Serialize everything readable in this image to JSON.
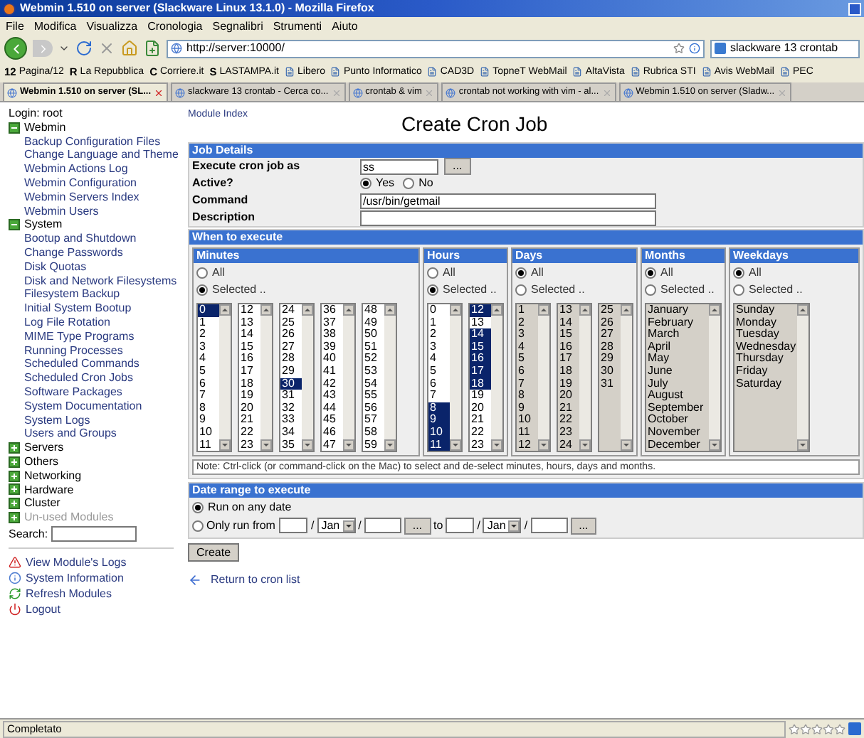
{
  "window": {
    "title": "Webmin 1.510 on server (Slackware Linux 13.1.0) - Mozilla Firefox"
  },
  "menu": [
    "File",
    "Modifica",
    "Visualizza",
    "Cronologia",
    "Segnalibri",
    "Strumenti",
    "Aiuto"
  ],
  "toolbar": {
    "url": "http://server:10000/",
    "search": "slackware 13 crontab"
  },
  "bookmarks": [
    {
      "logo": "12",
      "label": "Pagina/12"
    },
    {
      "logo": "R",
      "label": "La Repubblica"
    },
    {
      "logo": "C",
      "label": "Corriere.it"
    },
    {
      "logo": "S",
      "label": "LASTAMPA.it"
    },
    {
      "label": "Libero"
    },
    {
      "label": "Punto Informatico"
    },
    {
      "label": "CAD3D"
    },
    {
      "label": "TopneT WebMail"
    },
    {
      "label": "AltaVista"
    },
    {
      "label": "Rubrica STI"
    },
    {
      "label": "Avis WebMail"
    },
    {
      "label": "PEC"
    }
  ],
  "tabs": [
    {
      "label": "Webmin 1.510 on server (SL...",
      "selected": true
    },
    {
      "label": "slackware 13 crontab - Cerca co...",
      "selected": false
    },
    {
      "label": "crontab & vim",
      "selected": false
    },
    {
      "label": "crontab not working with vim - al...",
      "selected": false
    },
    {
      "label": "Webmin 1.510 on server (Sladw...",
      "selected": false
    }
  ],
  "sidebar": {
    "login": "Login: root",
    "categories": [
      {
        "label": "Webmin",
        "expanded": true,
        "disabled": false,
        "children": [
          "Backup Configuration Files",
          "Change Language and Theme",
          "Webmin Actions Log",
          "Webmin Configuration",
          "Webmin Servers Index",
          "Webmin Users"
        ]
      },
      {
        "label": "System",
        "expanded": true,
        "disabled": false,
        "children": [
          "Bootup and Shutdown",
          "Change Passwords",
          "Disk Quotas",
          "Disk and Network Filesystems",
          "Filesystem Backup",
          "Initial System Bootup",
          "Log File Rotation",
          "MIME Type Programs",
          "Running Processes",
          "Scheduled Commands",
          "Scheduled Cron Jobs",
          "Software Packages",
          "System Documentation",
          "System Logs",
          "Users and Groups"
        ]
      },
      {
        "label": "Servers",
        "expanded": false,
        "disabled": false
      },
      {
        "label": "Others",
        "expanded": false,
        "disabled": false
      },
      {
        "label": "Networking",
        "expanded": false,
        "disabled": false
      },
      {
        "label": "Hardware",
        "expanded": false,
        "disabled": false
      },
      {
        "label": "Cluster",
        "expanded": false,
        "disabled": false
      },
      {
        "label": "Un-used Modules",
        "expanded": false,
        "disabled": true
      }
    ],
    "search_label": "Search:",
    "links": [
      {
        "kind": "warning",
        "label": "View Module's Logs"
      },
      {
        "kind": "info",
        "label": "System Information"
      },
      {
        "kind": "refresh",
        "label": "Refresh Modules"
      },
      {
        "kind": "logout",
        "label": "Logout"
      }
    ]
  },
  "module_index": "Module Index",
  "title": "Create Cron Job",
  "job_details": {
    "heading": "Job Details",
    "fields": [
      {
        "kind": "user",
        "label": "Execute cron job as",
        "value": "ss",
        "button": "..."
      },
      {
        "kind": "radio",
        "label": "Active?",
        "options": [
          {
            "label": "Yes",
            "selected": true
          },
          {
            "label": "No",
            "selected": false
          }
        ]
      },
      {
        "kind": "text",
        "label": "Command",
        "value": "/usr/bin/getmail"
      },
      {
        "kind": "text",
        "label": "Description"
      }
    ]
  },
  "when": {
    "heading": "When to execute",
    "groups": [
      {
        "heading": "Minutes",
        "options": [
          {
            "label": "All",
            "selected": false
          },
          {
            "label": "Selected ..",
            "selected": true
          }
        ],
        "lists": [
          [
            {
              "label": "0",
              "selected": true
            },
            {
              "label": "1",
              "selected": false
            },
            {
              "label": "2",
              "selected": false
            },
            {
              "label": "3",
              "selected": false
            },
            {
              "label": "4",
              "selected": false
            },
            {
              "label": "5",
              "selected": false
            },
            {
              "label": "6",
              "selected": false
            },
            {
              "label": "7",
              "selected": false
            },
            {
              "label": "8",
              "selected": false
            },
            {
              "label": "9",
              "selected": false
            },
            {
              "label": "10",
              "selected": false
            },
            {
              "label": "11",
              "selected": false
            }
          ],
          [
            {
              "label": "12",
              "selected": false
            },
            {
              "label": "13",
              "selected": false
            },
            {
              "label": "14",
              "selected": false
            },
            {
              "label": "15",
              "selected": false
            },
            {
              "label": "16",
              "selected": false
            },
            {
              "label": "17",
              "selected": false
            },
            {
              "label": "18",
              "selected": false
            },
            {
              "label": "19",
              "selected": false
            },
            {
              "label": "20",
              "selected": false
            },
            {
              "label": "21",
              "selected": false
            },
            {
              "label": "22",
              "selected": false
            },
            {
              "label": "23",
              "selected": false
            }
          ],
          [
            {
              "label": "24",
              "selected": false
            },
            {
              "label": "25",
              "selected": false
            },
            {
              "label": "26",
              "selected": false
            },
            {
              "label": "27",
              "selected": false
            },
            {
              "label": "28",
              "selected": false
            },
            {
              "label": "29",
              "selected": false
            },
            {
              "label": "30",
              "selected": true
            },
            {
              "label": "31",
              "selected": false
            },
            {
              "label": "32",
              "selected": false
            },
            {
              "label": "33",
              "selected": false
            },
            {
              "label": "34",
              "selected": false
            },
            {
              "label": "35",
              "selected": false
            }
          ],
          [
            {
              "label": "36",
              "selected": false
            },
            {
              "label": "37",
              "selected": false
            },
            {
              "label": "38",
              "selected": false
            },
            {
              "label": "39",
              "selected": false
            },
            {
              "label": "40",
              "selected": false
            },
            {
              "label": "41",
              "selected": false
            },
            {
              "label": "42",
              "selected": false
            },
            {
              "label": "43",
              "selected": false
            },
            {
              "label": "44",
              "selected": false
            },
            {
              "label": "45",
              "selected": false
            },
            {
              "label": "46",
              "selected": false
            },
            {
              "label": "47",
              "selected": false
            }
          ],
          [
            {
              "label": "48",
              "selected": false
            },
            {
              "label": "49",
              "selected": false
            },
            {
              "label": "50",
              "selected": false
            },
            {
              "label": "51",
              "selected": false
            },
            {
              "label": "52",
              "selected": false
            },
            {
              "label": "53",
              "selected": false
            },
            {
              "label": "54",
              "selected": false
            },
            {
              "label": "55",
              "selected": false
            },
            {
              "label": "56",
              "selected": false
            },
            {
              "label": "57",
              "selected": false
            },
            {
              "label": "58",
              "selected": false
            },
            {
              "label": "59",
              "selected": false
            }
          ]
        ]
      },
      {
        "heading": "Hours",
        "options": [
          {
            "label": "All",
            "selected": false
          },
          {
            "label": "Selected ..",
            "selected": true
          }
        ],
        "lists": [
          [
            {
              "label": "0",
              "selected": false
            },
            {
              "label": "1",
              "selected": false
            },
            {
              "label": "2",
              "selected": false
            },
            {
              "label": "3",
              "selected": false
            },
            {
              "label": "4",
              "selected": false
            },
            {
              "label": "5",
              "selected": false
            },
            {
              "label": "6",
              "selected": false
            },
            {
              "label": "7",
              "selected": false
            },
            {
              "label": "8",
              "selected": true
            },
            {
              "label": "9",
              "selected": true
            },
            {
              "label": "10",
              "selected": true
            },
            {
              "label": "11",
              "selected": true
            }
          ],
          [
            {
              "label": "12",
              "selected": true
            },
            {
              "label": "13",
              "selected": false
            },
            {
              "label": "14",
              "selected": true
            },
            {
              "label": "15",
              "selected": true
            },
            {
              "label": "16",
              "selected": true
            },
            {
              "label": "17",
              "selected": true
            },
            {
              "label": "18",
              "selected": true
            },
            {
              "label": "19",
              "selected": false
            },
            {
              "label": "20",
              "selected": false
            },
            {
              "label": "21",
              "selected": false
            },
            {
              "label": "22",
              "selected": false
            },
            {
              "label": "23",
              "selected": false
            }
          ]
        ]
      },
      {
        "heading": "Days",
        "options": [
          {
            "label": "All",
            "selected": true
          },
          {
            "label": "Selected ..",
            "selected": false
          }
        ],
        "lists": [
          [
            {
              "label": "1",
              "selected": false
            },
            {
              "label": "2",
              "selected": false
            },
            {
              "label": "3",
              "selected": false
            },
            {
              "label": "4",
              "selected": false
            },
            {
              "label": "5",
              "selected": false
            },
            {
              "label": "6",
              "selected": false
            },
            {
              "label": "7",
              "selected": false
            },
            {
              "label": "8",
              "selected": false
            },
            {
              "label": "9",
              "selected": false
            },
            {
              "label": "10",
              "selected": false
            },
            {
              "label": "11",
              "selected": false
            },
            {
              "label": "12",
              "selected": false
            }
          ],
          [
            {
              "label": "13",
              "selected": false
            },
            {
              "label": "14",
              "selected": false
            },
            {
              "label": "15",
              "selected": false
            },
            {
              "label": "16",
              "selected": false
            },
            {
              "label": "17",
              "selected": false
            },
            {
              "label": "18",
              "selected": false
            },
            {
              "label": "19",
              "selected": false
            },
            {
              "label": "20",
              "selected": false
            },
            {
              "label": "21",
              "selected": false
            },
            {
              "label": "22",
              "selected": false
            },
            {
              "label": "23",
              "selected": false
            },
            {
              "label": "24",
              "selected": false
            }
          ],
          [
            {
              "label": "25",
              "selected": false
            },
            {
              "label": "26",
              "selected": false
            },
            {
              "label": "27",
              "selected": false
            },
            {
              "label": "28",
              "selected": false
            },
            {
              "label": "29",
              "selected": false
            },
            {
              "label": "30",
              "selected": false
            },
            {
              "label": "31",
              "selected": false
            }
          ]
        ]
      },
      {
        "heading": "Months",
        "options": [
          {
            "label": "All",
            "selected": true
          },
          {
            "label": "Selected ..",
            "selected": false
          }
        ],
        "lists": [
          [
            {
              "label": "January",
              "selected": false
            },
            {
              "label": "February",
              "selected": false
            },
            {
              "label": "March",
              "selected": false
            },
            {
              "label": "April",
              "selected": false
            },
            {
              "label": "May",
              "selected": false
            },
            {
              "label": "June",
              "selected": false
            },
            {
              "label": "July",
              "selected": false
            },
            {
              "label": "August",
              "selected": false
            },
            {
              "label": "September",
              "selected": false
            },
            {
              "label": "October",
              "selected": false
            },
            {
              "label": "November",
              "selected": false
            },
            {
              "label": "December",
              "selected": false
            }
          ]
        ]
      },
      {
        "heading": "Weekdays",
        "options": [
          {
            "label": "All",
            "selected": true
          },
          {
            "label": "Selected ..",
            "selected": false
          }
        ],
        "lists": [
          [
            {
              "label": "Sunday",
              "selected": false
            },
            {
              "label": "Monday",
              "selected": false
            },
            {
              "label": "Tuesday",
              "selected": false
            },
            {
              "label": "Wednesday",
              "selected": false
            },
            {
              "label": "Thursday",
              "selected": false
            },
            {
              "label": "Friday",
              "selected": false
            },
            {
              "label": "Saturday",
              "selected": false
            }
          ]
        ]
      }
    ],
    "note": "Note: Ctrl-click (or command-click on the Mac) to select and de-select minutes, hours, days and months."
  },
  "date_range": {
    "heading": "Date range to execute",
    "options": [
      {
        "label": "Run on any date",
        "selected": true
      },
      {
        "label": "Only run from",
        "selected": false
      }
    ],
    "from": {
      "separators": [
        "/",
        "/"
      ],
      "month": "Jan",
      "button": "..."
    },
    "to_label": "to",
    "to": {
      "separators": [
        "/",
        "/"
      ],
      "month": "Jan",
      "button": "..."
    }
  },
  "create_button": "Create",
  "return_link": "Return to cron list",
  "status_bar": {
    "text": "Completato",
    "stars": 0
  }
}
